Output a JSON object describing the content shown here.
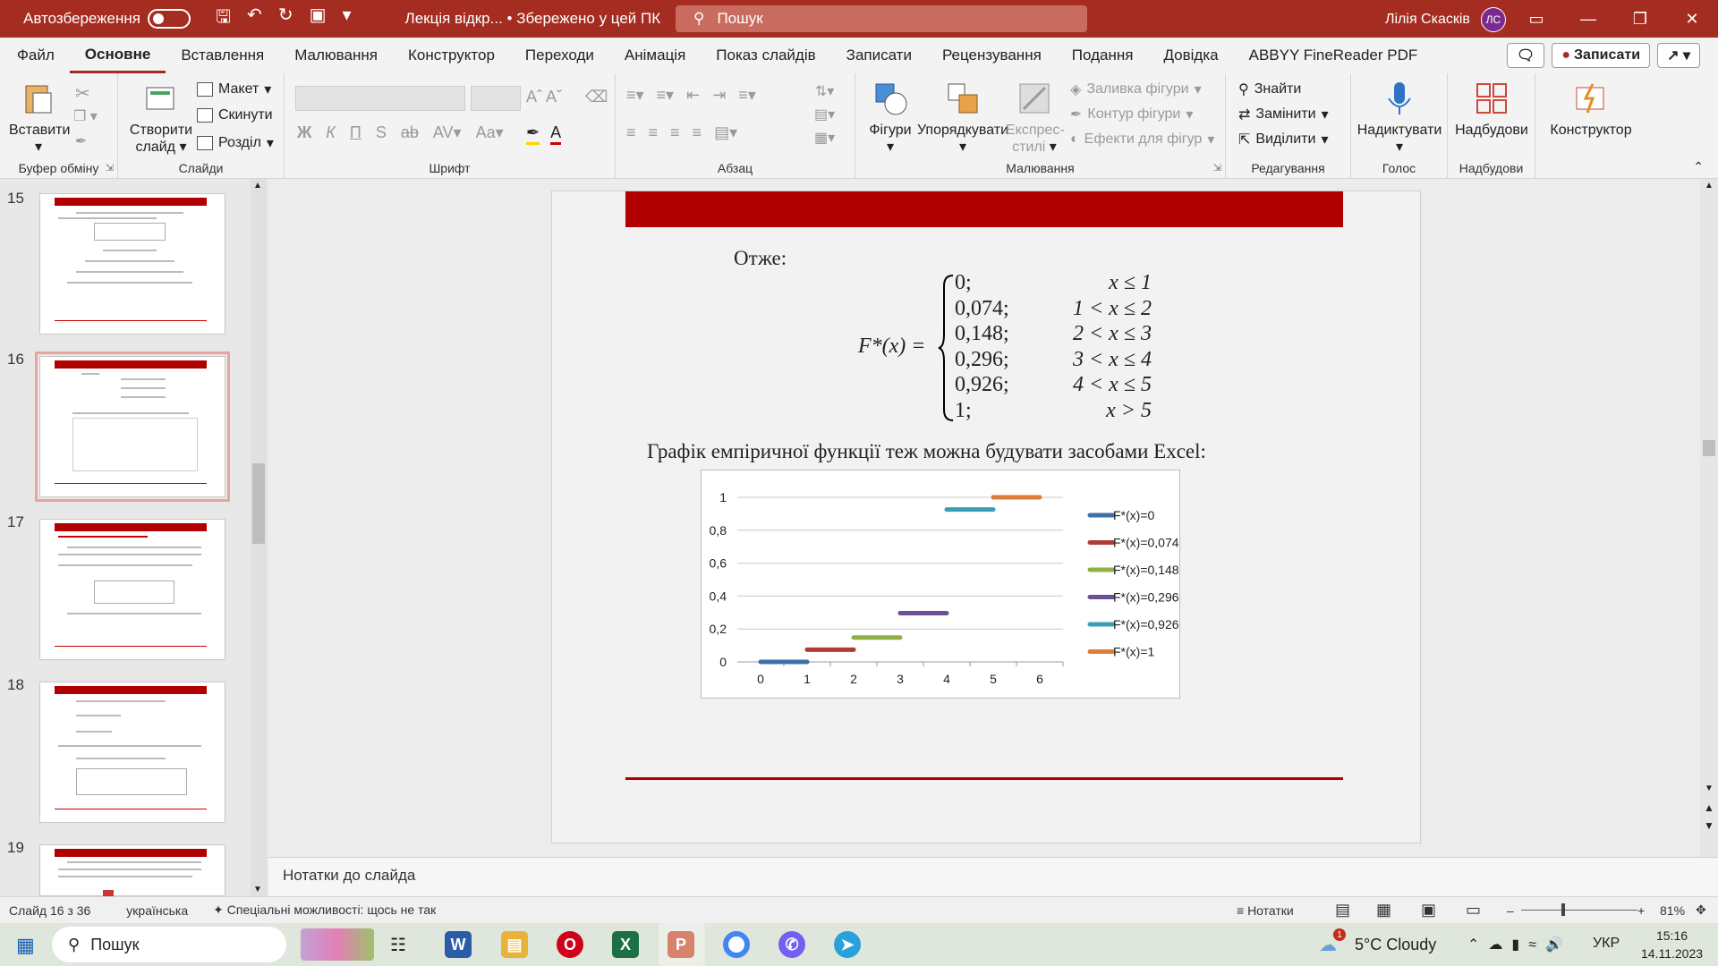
{
  "titlebar": {
    "autosave_label": "Автозбереження",
    "doc_title": "Лекція відкр... • Збережено у цей ПК",
    "search_placeholder": "Пошук",
    "user_name": "Лілія Скасків",
    "user_initials": "ЛС"
  },
  "tabs": [
    "Файл",
    "Основне",
    "Вставлення",
    "Малювання",
    "Конструктор",
    "Переходи",
    "Анімація",
    "Показ слайдів",
    "Записати",
    "Рецензування",
    "Подання",
    "Довідка",
    "ABBYY FineReader PDF"
  ],
  "active_tab": "Основне",
  "record_button": "Записати",
  "ribbon": {
    "clipboard": {
      "paste": "Вставити",
      "label": "Буфер обміну"
    },
    "slides": {
      "new_slide_1": "Створити",
      "new_slide_2": "слайд",
      "layout": "Макет",
      "reset": "Скинути",
      "section": "Розділ",
      "label": "Слайди"
    },
    "font": {
      "label": "Шрифт"
    },
    "paragraph": {
      "label": "Абзац"
    },
    "drawing": {
      "shapes": "Фігури",
      "arrange": "Упорядкувати",
      "quick_styles_1": "Експрес-",
      "quick_styles_2": "стилі",
      "fill": "Заливка фігури",
      "outline": "Контур фігури",
      "effects": "Ефекти для фігур",
      "label": "Малювання"
    },
    "editing": {
      "find": "Знайти",
      "replace": "Замінити",
      "select": "Виділити",
      "label": "Редагування"
    },
    "voice": {
      "dictate": "Надиктувати",
      "label": "Голос"
    },
    "addins": {
      "addins": "Надбудови",
      "label": "Надбудови"
    },
    "designer": {
      "designer": "Конструктор"
    }
  },
  "thumbnails": [
    {
      "num": "15"
    },
    {
      "num": "16"
    },
    {
      "num": "17"
    },
    {
      "num": "18"
    },
    {
      "num": "19"
    }
  ],
  "slide": {
    "heading": "Отже:",
    "func_label": "F*(x) =",
    "rows": [
      {
        "val": "0;",
        "cond": "x ≤ 1"
      },
      {
        "val": "0,074;",
        "cond": "1 < x ≤ 2"
      },
      {
        "val": "0,148;",
        "cond": "2 < x ≤ 3"
      },
      {
        "val": "0,296;",
        "cond": "3 < x ≤ 4"
      },
      {
        "val": "0,926;",
        "cond": "4 < x ≤ 5"
      },
      {
        "val": "1;",
        "cond": "x > 5"
      }
    ],
    "caption": "Графік емпіричної функції теж можна будувати засобами Excel:"
  },
  "chart_data": {
    "type": "line",
    "xticks": [
      "0",
      "1",
      "2",
      "3",
      "4",
      "5",
      "6"
    ],
    "yticks": [
      "0",
      "0,2",
      "0,4",
      "0,6",
      "0,8",
      "1"
    ],
    "xlim": [
      0,
      6
    ],
    "ylim": [
      0,
      1
    ],
    "grid": true,
    "legend_position": "right",
    "series": [
      {
        "name": "F*(x)=0",
        "x": [
          0,
          1
        ],
        "y": [
          0,
          0
        ],
        "color": "#3f6ea8"
      },
      {
        "name": "F*(x)=0,074",
        "x": [
          1,
          2
        ],
        "y": [
          0.074,
          0.074
        ],
        "color": "#b23b36"
      },
      {
        "name": "F*(x)=0,148",
        "x": [
          2,
          3
        ],
        "y": [
          0.148,
          0.148
        ],
        "color": "#8fb043"
      },
      {
        "name": "F*(x)=0,296",
        "x": [
          3,
          4
        ],
        "y": [
          0.296,
          0.296
        ],
        "color": "#6c4f96"
      },
      {
        "name": "F*(x)=0,926",
        "x": [
          4,
          5
        ],
        "y": [
          0.926,
          0.926
        ],
        "color": "#3a9fb6"
      },
      {
        "name": "F*(x)=1",
        "x": [
          5,
          6
        ],
        "y": [
          1,
          1
        ],
        "color": "#e07b39"
      }
    ]
  },
  "notes_placeholder": "Нотатки до слайда",
  "status": {
    "slide_info": "Слайд 16 з 36",
    "language": "українська",
    "accessibility": "Спеціальні можливості: щось не так",
    "notes": "Нотатки",
    "zoom": "81%"
  },
  "taskbar": {
    "search": "Пошук",
    "weather": "5°C  Cloudy",
    "lang": "УКР",
    "time": "15:16",
    "date": "14.11.2023",
    "weather_badge": "1"
  }
}
